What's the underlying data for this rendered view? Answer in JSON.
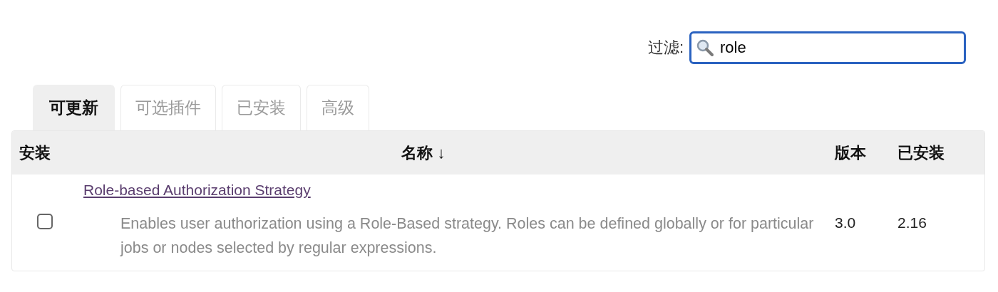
{
  "filter": {
    "label": "过滤:",
    "value": "role"
  },
  "tabs": [
    {
      "label": "可更新",
      "selected": true
    },
    {
      "label": "可选插件",
      "selected": false
    },
    {
      "label": "已安装",
      "selected": false
    },
    {
      "label": "高级",
      "selected": false
    }
  ],
  "table": {
    "columns": [
      "安装",
      "名称 ↓",
      "版本",
      "已安装"
    ],
    "rows": [
      {
        "checked": false,
        "name": "Role-based Authorization Strategy",
        "description": "Enables user authorization using a Role-Based strategy. Roles can be defined globally or for particular jobs or nodes selected by regular expressions.",
        "version": "3.0",
        "installed": "2.16"
      }
    ]
  }
}
